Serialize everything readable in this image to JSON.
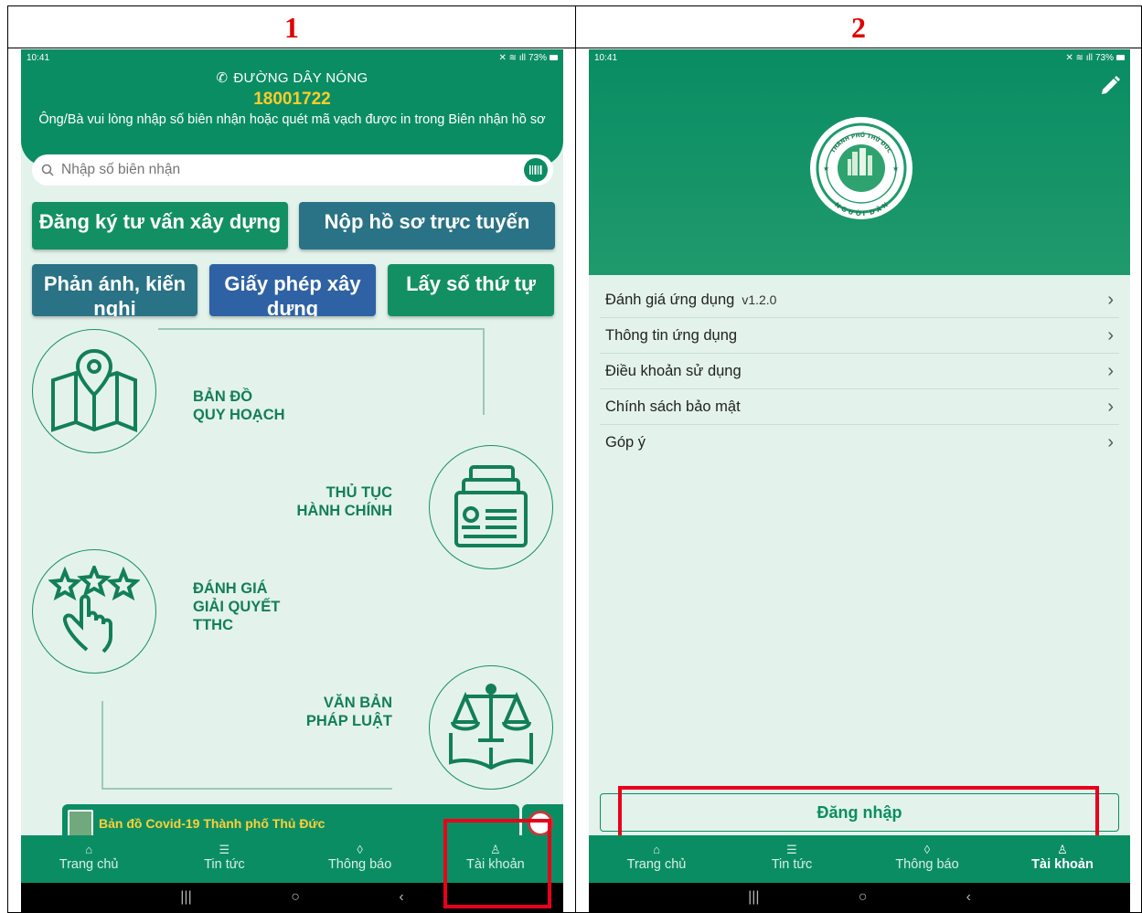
{
  "panels": {
    "left_number": "1",
    "right_number": "2"
  },
  "status": {
    "time": "10:41",
    "battery": "73%"
  },
  "screen1": {
    "hotline_title": "ĐƯỜNG DÂY NÓNG",
    "hotline_number": "18001722",
    "instruction": "Ông/Bà vui lòng nhập số biên nhận hoặc quét mã vạch được in trong Biên nhận hồ sơ",
    "search_placeholder": "Nhập số biên nhận",
    "buttons": {
      "dangky": "Đăng ký tư vấn xây dựng",
      "nophoso": "Nộp hồ sơ trực tuyến",
      "phananh": "Phản ánh, kiến nghị",
      "giayphep": "Giấy phép xây dựng",
      "layso": "Lấy số thứ tự"
    },
    "features": {
      "bando_l1": "BẢN ĐỒ",
      "bando_l2": "QUY HOẠCH",
      "thutuc_l1": "THỦ TỤC",
      "thutuc_l2": "HÀNH CHÍNH",
      "danhgia_l1": "ĐÁNH GIÁ",
      "danhgia_l2": "GIẢI QUYẾT",
      "danhgia_l3": "TTHC",
      "vanban_l1": "VĂN BẢN",
      "vanban_l2": "PHÁP LUẬT"
    },
    "banner_text": "Bản đồ Covid-19 Thành phố Thủ Đức"
  },
  "tabs": {
    "home": "Trang chủ",
    "news": "Tin tức",
    "notify": "Thông báo",
    "account": "Tài khoản"
  },
  "screen2": {
    "logo_top": "THÀNH PHỐ THỦ ĐỨC",
    "logo_bottom": "NGƯỜI DÂN",
    "menu": [
      {
        "label": "Đánh giá ứng dụng",
        "version": "v1.2.0"
      },
      {
        "label": "Thông tin ứng dụng"
      },
      {
        "label": "Điều khoản sử dụng"
      },
      {
        "label": "Chính sách bảo mật"
      },
      {
        "label": "Góp ý"
      }
    ],
    "login": "Đăng nhập"
  },
  "colors": {
    "primary": "#0b8d63",
    "hotline": "#ffcc2a",
    "highlight": "#e8001c",
    "background": "#e3f3eb"
  }
}
